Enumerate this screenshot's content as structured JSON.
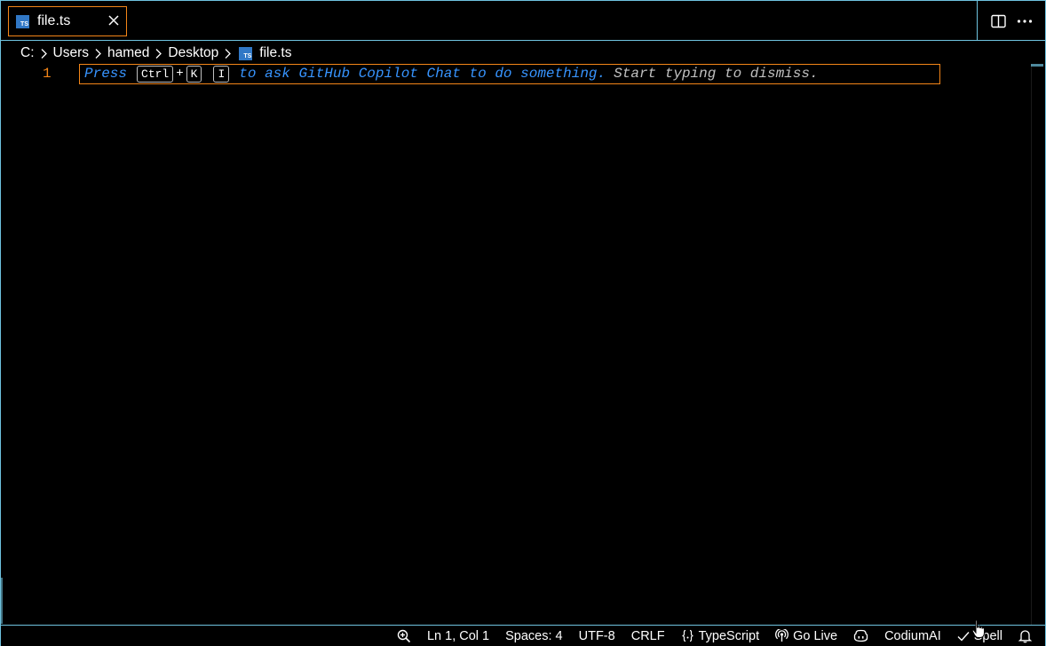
{
  "tab": {
    "file_icon_label": "TS",
    "label": "file.ts"
  },
  "tab_actions": {
    "split_editor_icon": "split-editor-icon",
    "more_actions_icon": "ellipsis-icon"
  },
  "breadcrumb": {
    "items": [
      "C:",
      "Users",
      "hamed",
      "Desktop",
      "file.ts"
    ],
    "file_icon_label": "TS"
  },
  "editor": {
    "line_number": "1",
    "hint": {
      "press": "Press",
      "key_ctrl": "Ctrl",
      "plus": "+",
      "key_k": "K",
      "key_i": "I",
      "ask_text": "to ask GitHub Copilot Chat to do something.",
      "dismiss_text": "Start typing to dismiss."
    }
  },
  "statusbar": {
    "zoom_icon": "zoom-in-icon",
    "position": "Ln 1, Col 1",
    "indentation": "Spaces: 4",
    "encoding": "UTF-8",
    "line_ending": "CRLF",
    "language_icon": "braces-icon",
    "language": "TypeScript",
    "go_live_icon": "broadcast-icon",
    "go_live": "Go Live",
    "copilot_icon": "copilot-icon",
    "codium": "CodiumAI",
    "spell_icon": "check-icon",
    "spell": "Spell",
    "notifications_icon": "bell-icon"
  },
  "colors": {
    "accent_border": "#6fc3df",
    "active_border": "#f38518",
    "hint_blue": "#3794ff",
    "ts_blue": "#3178c6"
  }
}
